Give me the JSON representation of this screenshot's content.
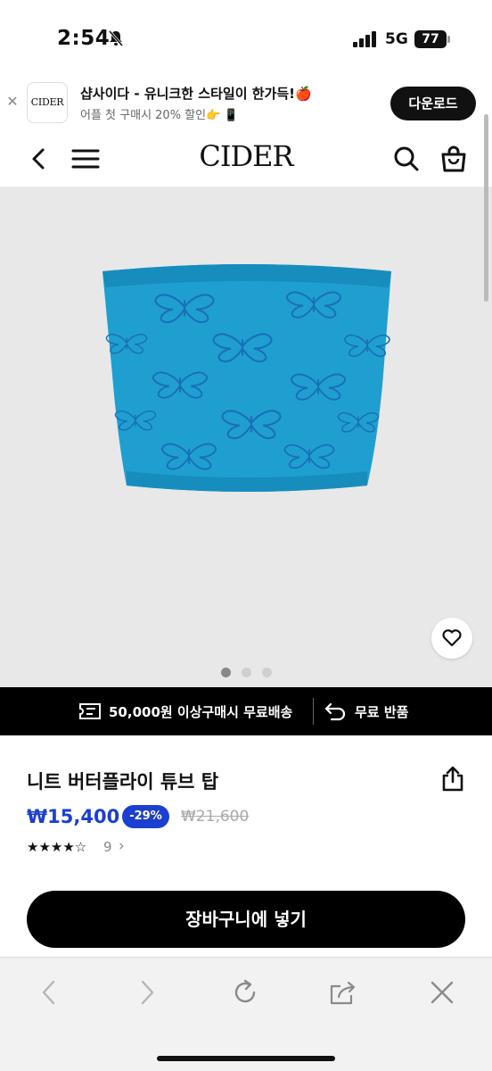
{
  "status_bar": {
    "time": "2:54",
    "network": "5G",
    "battery": "77"
  },
  "app_banner": {
    "logo_text": "CIDER",
    "title": "샵사이다 - 유니크한 스타일이 한가득!🍎",
    "subtitle": "어플 첫 구매시 20% 할인👉 📱",
    "download_label": "다운로드"
  },
  "nav": {
    "logo": "CIDER"
  },
  "gallery": {
    "total_images": 3,
    "active_index": 0
  },
  "info_strip": {
    "shipping_text": "50,000원 이상구매시 무료배송",
    "return_text": "무료 반품"
  },
  "product": {
    "title": "니트 버터플라이 튜브 탑",
    "price": "₩15,400",
    "discount": "-29%",
    "original_price": "₩21,600",
    "rating_stars": "★★★★☆",
    "rating_value": 4,
    "review_count": "9",
    "review_chevron": "›",
    "color": "#1e9fd0"
  },
  "cart": {
    "label": "장바구니에 넣기"
  },
  "colors": {
    "accent": "#1b3fd1",
    "black": "#000000",
    "image_bg": "#e8e8e8"
  }
}
